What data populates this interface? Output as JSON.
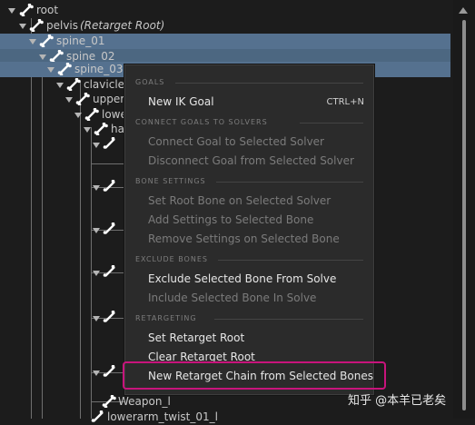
{
  "tree": {
    "rows": [
      {
        "label": "root",
        "extra": ""
      },
      {
        "label": "pelvis",
        "extra": "(Retarget Root)"
      },
      {
        "label": "spine_01",
        "extra": ""
      },
      {
        "label": "spine_02",
        "extra": ""
      },
      {
        "label": "spine_03",
        "extra": ""
      },
      {
        "label": "clavicle_l",
        "extra": ""
      },
      {
        "label": "upperarm_l",
        "extra": ""
      },
      {
        "label": "lowerarm_l",
        "extra": ""
      },
      {
        "label": "hand_l",
        "extra": ""
      },
      {
        "label": "Weapon_l",
        "extra": ""
      },
      {
        "label": "lowerarm_twist_01_l",
        "extra": ""
      }
    ]
  },
  "context_menu": {
    "sections": [
      {
        "header": "GOALS",
        "items": [
          {
            "label": "New IK Goal",
            "shortcut": "CTRL+N",
            "enabled": true
          }
        ]
      },
      {
        "header": "CONNECT GOALS TO SOLVERS",
        "items": [
          {
            "label": "Connect Goal to Selected Solver",
            "enabled": false
          },
          {
            "label": "Disconnect Goal from Selected Solver",
            "enabled": false
          }
        ]
      },
      {
        "header": "BONE SETTINGS",
        "items": [
          {
            "label": "Set Root Bone on Selected Solver",
            "enabled": false
          },
          {
            "label": "Add Settings to Selected Bone",
            "enabled": false
          },
          {
            "label": "Remove Settings on Selected Bone",
            "enabled": false
          }
        ]
      },
      {
        "header": "EXCLUDE BONES",
        "items": [
          {
            "label": "Exclude Selected Bone From Solve",
            "enabled": true
          },
          {
            "label": "Include Selected Bone In Solve",
            "enabled": false
          }
        ]
      },
      {
        "header": "RETARGETING",
        "items": [
          {
            "label": "Set Retarget Root",
            "enabled": true
          },
          {
            "label": "Clear Retarget Root",
            "enabled": true
          },
          {
            "label": "New Retarget Chain from Selected Bones",
            "enabled": true
          }
        ]
      }
    ]
  },
  "watermark": "知乎 @本羊已老矣",
  "colors": {
    "selection": "#55718f",
    "highlight_border": "#c8147c",
    "menu_bg": "#2b2b2b"
  }
}
